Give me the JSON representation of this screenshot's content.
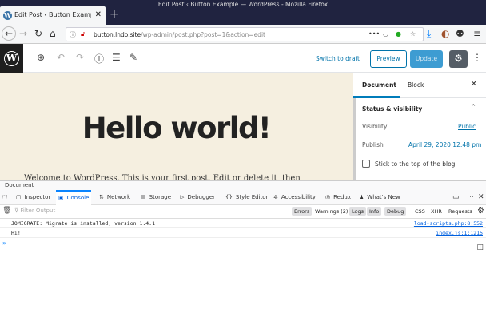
{
  "browser": {
    "window_title": "Edit Post ‹ Button Example — WordPress - Mozilla Firefox",
    "tab_title": "Edit Post ‹ Button Example",
    "tab_favicon": "wordpress-icon",
    "url_host": "button.lndo.site",
    "url_path": "/wp-admin/post.php?post=1&action=edit",
    "url_dots": "•••"
  },
  "editor_toolbar": {
    "switch_to_draft": "Switch to draft",
    "preview": "Preview",
    "update": "Update"
  },
  "post": {
    "title": "Hello world!",
    "paragraph": "Welcome to WordPress. This is your first post. Edit or delete it, then"
  },
  "sidebar": {
    "tabs": [
      "Document",
      "Block"
    ],
    "section_title": "Status & visibility",
    "visibility_label": "Visibility",
    "visibility_value": "Public",
    "publish_label": "Publish",
    "publish_value": "April 29, 2020 12:48 pm",
    "sticky_label": "Stick to the top of the blog"
  },
  "devtools": {
    "breadcrumb": "Document",
    "tabs": [
      "Inspector",
      "Console",
      "Network",
      "Storage",
      "Debugger",
      "Style Editor",
      "Accessibility",
      "Redux",
      "What's New"
    ],
    "active_tab": "Console",
    "filter_placeholder": "Filter Output",
    "filters": [
      "Errors",
      "Warnings (2)",
      "Logs",
      "Info",
      "Debug"
    ],
    "extra_filters": [
      "CSS",
      "XHR",
      "Requests"
    ],
    "logs": [
      {
        "message": "JOMIGRATE: Migrate is installed, version 1.4.1",
        "source": "load-scripts.php:8:552"
      },
      {
        "message": "Hi!",
        "source": "index.js:1:1215"
      }
    ],
    "prompt": "»"
  },
  "colors": {
    "accent": "#0073aa",
    "update_button": "#3d9cd2",
    "canvas_bg": "#f5efe0",
    "firefox_chrome": "#202340"
  }
}
